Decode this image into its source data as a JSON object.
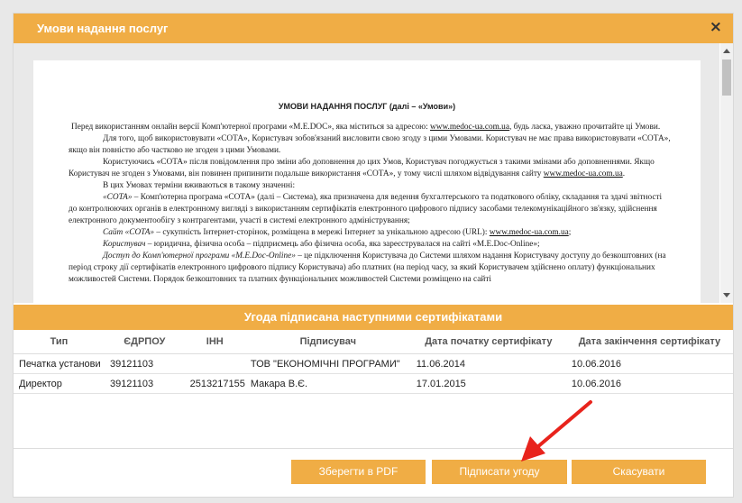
{
  "dialog": {
    "title": "Умови надання послуг",
    "close_icon": "×"
  },
  "document": {
    "heading": "УМОВИ НАДАННЯ ПОСЛУГ (далі – «Умови»)",
    "paragraphs": [
      {
        "indent": false,
        "parts": [
          {
            "t": "Перед використанням онлайн версії Комп'ютерної програми «M.E.DOC», яка міститься за адресою: "
          },
          {
            "t": "www.medoc-ua.com.ua",
            "link": true
          },
          {
            "t": ", будь ласка, уважно прочитайте ці Умови."
          }
        ]
      },
      {
        "indent": true,
        "parts": [
          {
            "t": "Для того, щоб використовувати «СОТА», Користувач зобов'язаний висловити свою згоду з цими Умовами. Користувач не має права використовувати «СОТА», якщо він повністю або частково не згоден з цими Умовами."
          }
        ]
      },
      {
        "indent": true,
        "parts": [
          {
            "t": "Користуючись «СОТА» після повідомлення про зміни або доповнення до цих Умов, Користувач погоджується з такими змінами або доповненнями. Якщо Користувач не згоден з Умовами, він повинен припинити подальше використання «СОТА», у тому числі шляхом відвідування сайту "
          },
          {
            "t": "www.medoc-ua.com.ua",
            "link": true
          },
          {
            "t": "."
          }
        ]
      },
      {
        "indent": true,
        "parts": [
          {
            "t": "В цих Умовах терміни вживаються в такому значенні:"
          }
        ]
      },
      {
        "indent": true,
        "parts": [
          {
            "t": "«СОТА»",
            "i": true
          },
          {
            "t": " – Комп'ютерна програма «СОТА» (далі – Система), яка призначена для ведення бухгалтерського та податкового обліку, складання та здачі звітності до контролюючих органів в електронному вигляді з використанням сертифікатів електронного цифрового підпису засобами телекомунікаційного зв'язку, здійснення електронного документообігу з контрагентами, участі в системі електронного адміністрування;"
          }
        ]
      },
      {
        "indent": true,
        "parts": [
          {
            "t": "Сайт «СОТА»",
            "i": true
          },
          {
            "t": " – сукупність Інтернет-сторінок, розміщена в мережі Інтернет за унікальною адресою (URL): "
          },
          {
            "t": "www.medoc-ua.com.ua",
            "link": true
          },
          {
            "t": ";"
          }
        ]
      },
      {
        "indent": true,
        "parts": [
          {
            "t": "Користувач",
            "i": true
          },
          {
            "t": " – юридична, фізична особа – підприємець або фізична особа, яка зареєструвалася на сайті «M.E.Doc-Online»;"
          }
        ]
      },
      {
        "indent": true,
        "parts": [
          {
            "t": "Доступ до Комп'ютерної програми «M.E.Doc-Online»",
            "i": true
          },
          {
            "t": " – це підключення Користувача до Системи шляхом надання Користувачу доступу до безкоштовних (на період строку дії сертифікатів електронного цифрового підпису Користувача) або платних (на період часу, за який Користувачем здійснено оплату) функціональних можливостей Системи. Порядок безкоштовних та платних функціональних можливостей Системи розміщено на сайті"
          }
        ]
      }
    ]
  },
  "certificates": {
    "header": "Угода підписана наступними сертифікатами",
    "columns": [
      "Тип",
      "ЄДРПОУ",
      "ІНН",
      "Підписувач",
      "Дата початку сертифікату",
      "Дата закінчення сертифікату"
    ],
    "rows": [
      [
        "Печатка установи",
        "39121103",
        "",
        "ТОВ \"ЕКОНОМІЧНІ ПРОГРАМИ\"",
        "11.06.2014",
        "10.06.2016"
      ],
      [
        "Директор",
        "39121103",
        "2513217155",
        "Макара В.Є.",
        "17.01.2015",
        "10.06.2016"
      ]
    ]
  },
  "buttons": {
    "save_pdf": "Зберегти в PDF",
    "sign": "Підписати угоду",
    "cancel": "Скасувати"
  },
  "colors": {
    "accent": "#f0ad45",
    "arrow": "#e8231c"
  },
  "icons": {
    "close": "close-icon",
    "annotation": "red-arrow-icon"
  }
}
